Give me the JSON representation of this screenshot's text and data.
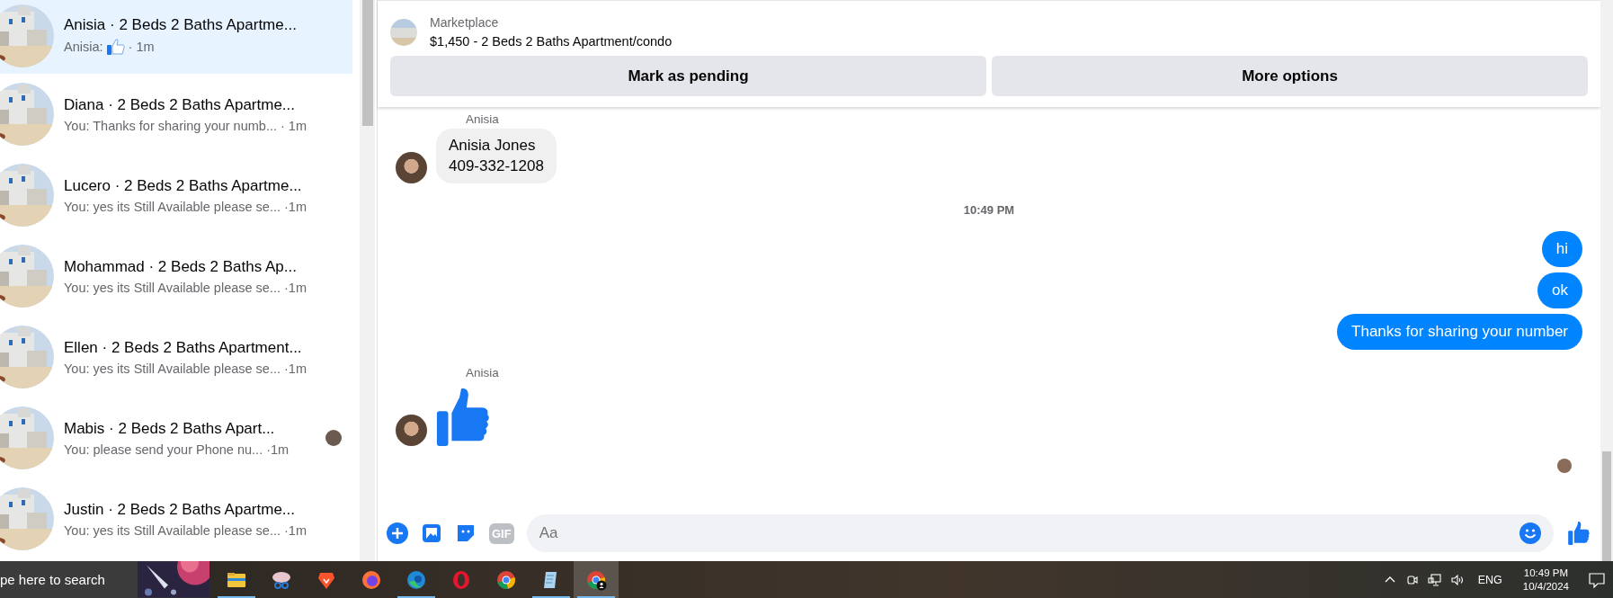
{
  "conversations": [
    {
      "title": "Anisia · 2 Beds 2 Baths Apartme...",
      "kind": "reaction",
      "preview": "Anisia:",
      "time": "· 1m",
      "selected": true,
      "seen_avatar": false
    },
    {
      "title": "Diana · 2 Beds 2 Baths Apartme...",
      "kind": "text",
      "preview": "You: Thanks for sharing your numb...",
      "time": "· 1m",
      "selected": false,
      "seen_avatar": false
    },
    {
      "title": "Lucero · 2 Beds 2 Baths Apartme...",
      "kind": "text",
      "preview": "You: yes its Still Available please se...",
      "time": "·1m",
      "selected": false,
      "seen_avatar": false
    },
    {
      "title": "Mohammad · 2 Beds 2 Baths Ap...",
      "kind": "text",
      "preview": "You: yes its Still Available please se...",
      "time": "·1m",
      "selected": false,
      "seen_avatar": false
    },
    {
      "title": "Ellen · 2 Beds 2 Baths Apartment...",
      "kind": "text",
      "preview": "You: yes its Still Available please se...",
      "time": "·1m",
      "selected": false,
      "seen_avatar": false
    },
    {
      "title": "Mabis · 2 Beds 2 Baths Apart...",
      "kind": "text",
      "preview": "You: please send your Phone nu...",
      "time": "·1m",
      "selected": false,
      "seen_avatar": true
    },
    {
      "title": "Justin · 2 Beds 2 Baths Apartme...",
      "kind": "text",
      "preview": "You: yes its Still Available please se...",
      "time": "·1m",
      "selected": false,
      "seen_avatar": false
    }
  ],
  "listing": {
    "label": "Marketplace",
    "title": "$1,450 - 2 Beds 2 Baths Apartment/condo",
    "buttons": [
      "Mark as pending",
      "More options"
    ]
  },
  "messages": [
    {
      "kind": "sender",
      "text": "Anisia"
    },
    {
      "kind": "incoming",
      "lines": [
        "Anisia Jones",
        "409-332-1208"
      ]
    },
    {
      "kind": "time",
      "text": "10:49 PM"
    },
    {
      "kind": "outgoing",
      "text": "hi"
    },
    {
      "kind": "outgoing",
      "text": "ok"
    },
    {
      "kind": "outgoing",
      "text": "Thanks for sharing your number"
    },
    {
      "kind": "sender",
      "text": "Anisia"
    },
    {
      "kind": "like"
    },
    {
      "kind": "seen"
    }
  ],
  "composer": {
    "gif_label": "GIF",
    "placeholder": "Aa"
  },
  "taskbar": {
    "search_placeholder": "pe here to search",
    "apps": [
      {
        "kind": "folder",
        "running": true,
        "selected": false
      },
      {
        "kind": "snip",
        "running": false,
        "selected": false
      },
      {
        "kind": "brave",
        "running": false,
        "selected": false
      },
      {
        "kind": "firefox",
        "running": false,
        "selected": false
      },
      {
        "kind": "edge",
        "running": true,
        "selected": false
      },
      {
        "kind": "opera",
        "running": false,
        "selected": false
      },
      {
        "kind": "chrome",
        "running": false,
        "selected": false
      },
      {
        "kind": "notepad",
        "running": true,
        "selected": false
      },
      {
        "kind": "chrome-profile",
        "running": true,
        "selected": true
      }
    ],
    "language": "ENG",
    "time": "10:49 PM",
    "date": "10/4/2024"
  }
}
